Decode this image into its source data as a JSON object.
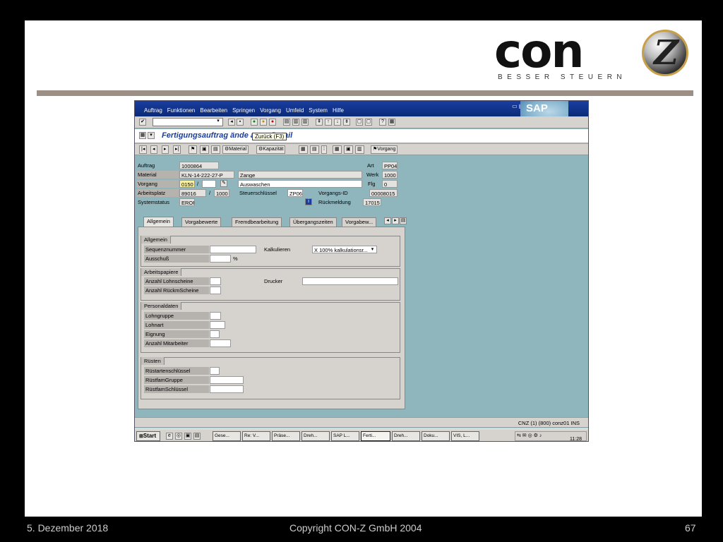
{
  "logo": {
    "word": "con",
    "badge_letter": "Z",
    "tagline": "BESSER STEUERN"
  },
  "footer": {
    "date": "5. Dezember 2018",
    "copyright": "Copyright CON-Z GmbH 2004",
    "page": "67"
  },
  "sap": {
    "logo_text": "SAP",
    "menu": [
      "Auftrag",
      "Funktionen",
      "Bearbeiten",
      "Springen",
      "Vorgang",
      "Umfeld",
      "System",
      "Hilfe"
    ],
    "title": "Fertigungsauftrag ände       ang - Detail",
    "tooltip": "Zurück  (F3)",
    "app_buttons": {
      "material": "Material",
      "kapazitat": "Kapazität",
      "vorgang": "Vorgang"
    },
    "header": {
      "auftrag_label": "Auftrag",
      "auftrag_value": "1000864",
      "art_label": "Art",
      "art_value": "PP04",
      "material_label": "Material",
      "material_value": "KLN-14-222-27-P",
      "material_desc": "Zange",
      "werk_label": "Werk",
      "werk_value": "1000",
      "vorgang_label": "Vorgang",
      "vorgang_value": "0150",
      "vorgang_sep": "/",
      "vorgang_desc": "Auswaschen",
      "flg_label": "Flg",
      "flg_value": "0",
      "arbeitsplatz_label": "Arbeitsplatz",
      "arbeitsplatz_value": "89016",
      "arbeitsplatz_sep": "/",
      "arbeitsplatz_werk": "1000",
      "steuerschluessel_label": "Steuerschlüssel",
      "steuerschluessel_value": "ZP06",
      "vorgangs_id_label": "Vorgangs-ID",
      "vorgangs_id_value": "00008015",
      "systemstatus_label": "Systemstatus",
      "systemstatus_value": "EROF",
      "rueckmeldung_label": "Rückmeldung",
      "rueckmeldung_value": "17015"
    },
    "tabs": [
      "Allgemein",
      "Vorgabewerte",
      "Fremdbearbeitung",
      "Übergangszeiten",
      "Vorgabew..."
    ],
    "groups": {
      "allgemein": {
        "title": "Allgemein",
        "sequenznummer": "Sequenznummer",
        "kalkulieren": "Kalkulieren",
        "kalkulieren_value": "X 100% kalkulationsr...",
        "ausschuss": "Ausschuß",
        "percent": "%"
      },
      "arbeitspapiere": {
        "title": "Arbeitspapiere",
        "lohnscheine": "Anzahl Lohnscheine",
        "drucker": "Drucker",
        "rueckmscheine": "Anzahl RückmScheine"
      },
      "personaldaten": {
        "title": "Personaldaten",
        "lohngruppe": "Lohngruppe",
        "lohnart": "Lohnart",
        "eignung": "Eignung",
        "mitarbeiter": "Anzahl Mitarbeiter"
      },
      "ruesten": {
        "title": "Rüsten",
        "ruestartenschluessel": "Rüstartenschlüssel",
        "ruestfamgruppe": "RüstfamGruppe",
        "ruestfamschluessel": "RüstfamSchlüssel"
      }
    },
    "status_bar": "CNZ (1) (800)   conz01   INS",
    "taskbar": {
      "start": "Start",
      "tasks": [
        "Gese...",
        "Re: V...",
        "Präse...",
        "Dreh...",
        "SAP L...",
        "Ferti...",
        "Dreh...",
        "Doku...",
        "VIS, L..."
      ],
      "clock": "11:28"
    }
  }
}
